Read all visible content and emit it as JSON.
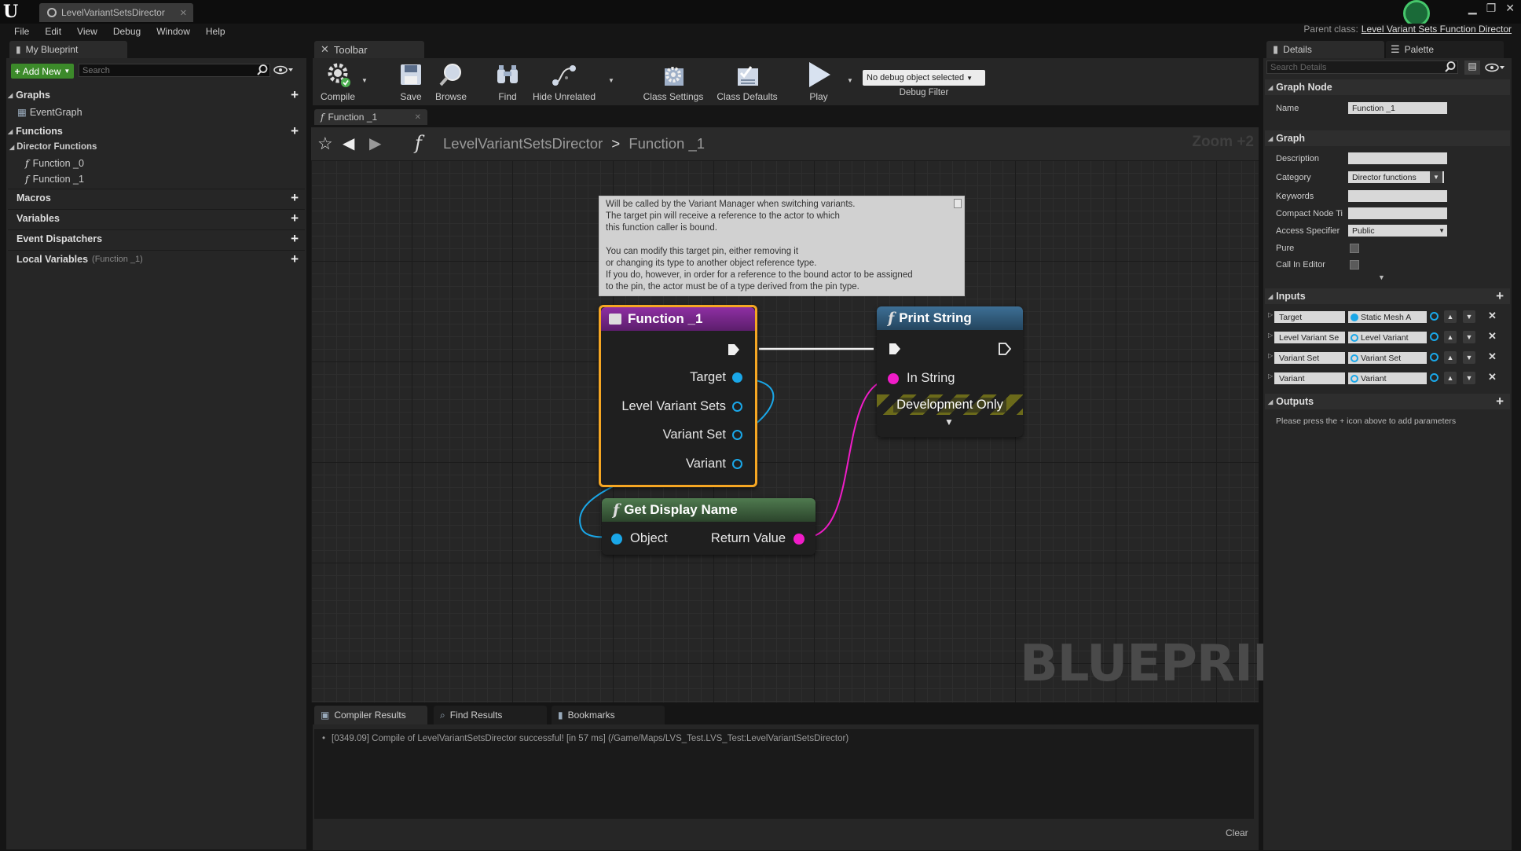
{
  "window": {
    "tab_title": "LevelVariantSetsDirector",
    "parent_class_label": "Parent class:",
    "parent_class_value": "Level Variant Sets Function Director"
  },
  "menu": [
    "File",
    "Edit",
    "View",
    "Debug",
    "Window",
    "Help"
  ],
  "my_blueprint": {
    "tab_label": "My Blueprint",
    "add_new_label": "Add New",
    "search_placeholder": "Search",
    "sections": {
      "graphs": "Graphs",
      "event_graph": "EventGraph",
      "functions": "Functions",
      "director_functions": "Director Functions",
      "function_items": [
        "Function _0",
        "Function _1"
      ],
      "macros": "Macros",
      "variables": "Variables",
      "event_dispatchers": "Event Dispatchers",
      "local_variables": "Local Variables",
      "local_variables_context": "(Function _1)"
    }
  },
  "toolbar": {
    "tab_label": "Toolbar",
    "buttons": {
      "compile": "Compile",
      "save": "Save",
      "browse": "Browse",
      "find": "Find",
      "hide_unrelated": "Hide Unrelated",
      "class_settings": "Class Settings",
      "class_defaults": "Class Defaults",
      "play": "Play"
    },
    "debug_object": "No debug object selected",
    "debug_filter_label": "Debug Filter"
  },
  "graph": {
    "tab_label": "Function _1",
    "breadcrumb_root": "LevelVariantSetsDirector",
    "breadcrumb_sep": ">",
    "breadcrumb_current": "Function _1",
    "zoom": "Zoom +2",
    "watermark": "BLUEPRINT",
    "comment_text": "Will be called by the Variant Manager when switching variants.\nThe target pin will receive a reference to the actor to which\nthis function caller is bound.\n\nYou can modify this target pin, either removing it\nor changing its type to another object reference type.\nIf you do, however, in order for a reference to the bound actor to be assigned\nto the pin, the actor must be of a type derived from the pin type.",
    "nodes": {
      "function_entry": {
        "title": "Function _1",
        "pins": [
          "Target",
          "Level Variant Sets",
          "Variant Set",
          "Variant"
        ]
      },
      "print_string": {
        "title": "Print String",
        "in_string": "In String",
        "dev_only": "Development Only"
      },
      "get_display_name": {
        "title": "Get Display Name",
        "object": "Object",
        "return_value": "Return Value"
      }
    },
    "colors": {
      "function_header": "#7a2a8a",
      "print_header": "#2f5a7a",
      "get_header": "#456a45",
      "object_pin": "#1aa7e8",
      "string_pin": "#f01cc8",
      "selection": "#f5a623"
    }
  },
  "bottom": {
    "tabs": [
      "Compiler Results",
      "Find Results",
      "Bookmarks"
    ],
    "log": "[0349.09] Compile of LevelVariantSetsDirector successful! [in 57 ms] (/Game/Maps/LVS_Test.LVS_Test:LevelVariantSetsDirector)",
    "clear_label": "Clear"
  },
  "details": {
    "tab_label": "Details",
    "palette_label": "Palette",
    "search_placeholder": "Search Details",
    "graph_node_section": "Graph Node",
    "name_label": "Name",
    "name_value": "Function _1",
    "graph_section": "Graph",
    "description_label": "Description",
    "description_value": "",
    "category_label": "Category",
    "category_value": "Director functions",
    "keywords_label": "Keywords",
    "keywords_value": "",
    "compact_label": "Compact Node Ti",
    "compact_value": "",
    "access_label": "Access Specifier",
    "access_value": "Public",
    "pure_label": "Pure",
    "call_in_editor_label": "Call In Editor",
    "inputs_section": "Inputs",
    "inputs": [
      {
        "name": "Target",
        "type": "Static Mesh A"
      },
      {
        "name": "Level Variant Se",
        "type": "Level Variant"
      },
      {
        "name": "Variant Set",
        "type": "Variant Set"
      },
      {
        "name": "Variant",
        "type": "Variant"
      }
    ],
    "outputs_section": "Outputs",
    "outputs_hint": "Please press the + icon above to add parameters"
  }
}
